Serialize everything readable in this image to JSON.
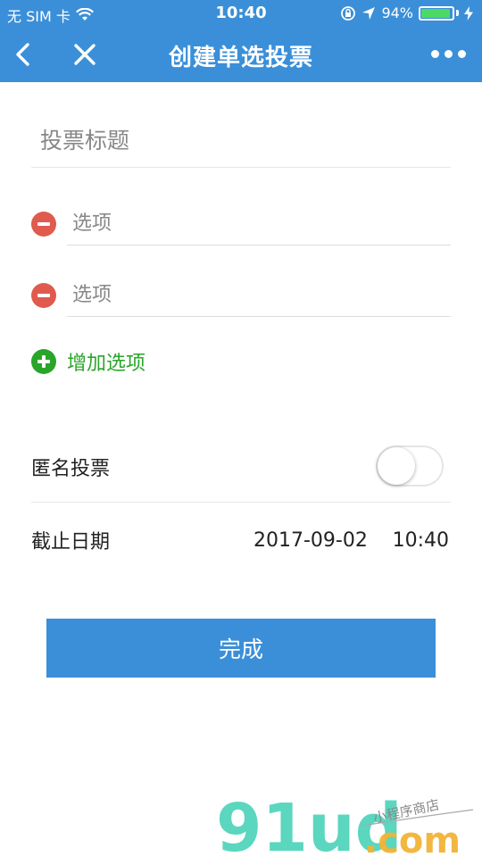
{
  "status_bar": {
    "carrier": "无 SIM 卡",
    "time": "10:40",
    "battery_percent": "94%",
    "battery_level": 0.94,
    "icons": [
      "wifi-icon",
      "lock-rotation-icon",
      "location-arrow-icon",
      "charging-bolt-icon"
    ]
  },
  "navbar": {
    "title": "创建单选投票",
    "icons": [
      "back-chevron-icon",
      "close-icon",
      "more-dots-icon"
    ]
  },
  "form": {
    "title_placeholder": "投票标题",
    "options": [
      {
        "placeholder": "选项"
      },
      {
        "placeholder": "选项"
      }
    ],
    "add_option_label": "增加选项",
    "anonymous_label": "匿名投票",
    "anonymous_enabled": false,
    "deadline_label": "截止日期",
    "deadline_date": "2017-09-02",
    "deadline_time": "10:40",
    "submit_label": "完成"
  },
  "watermark": {
    "brand": "91ud",
    "domain": ".com",
    "tagline": "小程序商店"
  },
  "colors": {
    "primary": "#3a8fd8",
    "remove": "#e05a4e",
    "add": "#2aa52a",
    "battery": "#4cd964"
  }
}
